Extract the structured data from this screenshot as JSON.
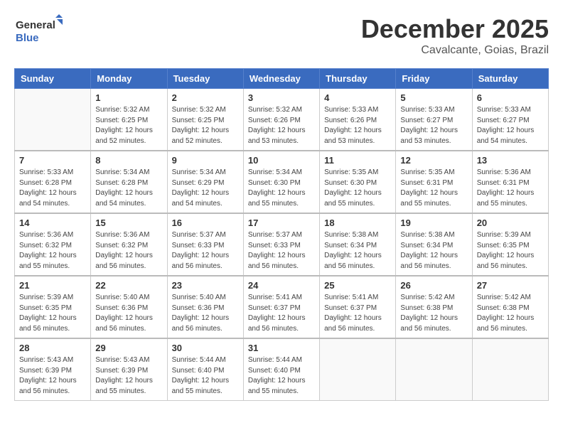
{
  "logo": {
    "line1": "General",
    "line2": "Blue"
  },
  "title": "December 2025",
  "location": "Cavalcante, Goias, Brazil",
  "weekdays": [
    "Sunday",
    "Monday",
    "Tuesday",
    "Wednesday",
    "Thursday",
    "Friday",
    "Saturday"
  ],
  "weeks": [
    [
      {
        "day": "",
        "empty": true
      },
      {
        "day": "1",
        "sunrise": "5:32 AM",
        "sunset": "6:25 PM",
        "daylight": "12 hours and 52 minutes."
      },
      {
        "day": "2",
        "sunrise": "5:32 AM",
        "sunset": "6:25 PM",
        "daylight": "12 hours and 52 minutes."
      },
      {
        "day": "3",
        "sunrise": "5:32 AM",
        "sunset": "6:26 PM",
        "daylight": "12 hours and 53 minutes."
      },
      {
        "day": "4",
        "sunrise": "5:33 AM",
        "sunset": "6:26 PM",
        "daylight": "12 hours and 53 minutes."
      },
      {
        "day": "5",
        "sunrise": "5:33 AM",
        "sunset": "6:27 PM",
        "daylight": "12 hours and 53 minutes."
      },
      {
        "day": "6",
        "sunrise": "5:33 AM",
        "sunset": "6:27 PM",
        "daylight": "12 hours and 54 minutes."
      }
    ],
    [
      {
        "day": "7",
        "sunrise": "5:33 AM",
        "sunset": "6:28 PM",
        "daylight": "12 hours and 54 minutes."
      },
      {
        "day": "8",
        "sunrise": "5:34 AM",
        "sunset": "6:28 PM",
        "daylight": "12 hours and 54 minutes."
      },
      {
        "day": "9",
        "sunrise": "5:34 AM",
        "sunset": "6:29 PM",
        "daylight": "12 hours and 54 minutes."
      },
      {
        "day": "10",
        "sunrise": "5:34 AM",
        "sunset": "6:30 PM",
        "daylight": "12 hours and 55 minutes."
      },
      {
        "day": "11",
        "sunrise": "5:35 AM",
        "sunset": "6:30 PM",
        "daylight": "12 hours and 55 minutes."
      },
      {
        "day": "12",
        "sunrise": "5:35 AM",
        "sunset": "6:31 PM",
        "daylight": "12 hours and 55 minutes."
      },
      {
        "day": "13",
        "sunrise": "5:36 AM",
        "sunset": "6:31 PM",
        "daylight": "12 hours and 55 minutes."
      }
    ],
    [
      {
        "day": "14",
        "sunrise": "5:36 AM",
        "sunset": "6:32 PM",
        "daylight": "12 hours and 55 minutes."
      },
      {
        "day": "15",
        "sunrise": "5:36 AM",
        "sunset": "6:32 PM",
        "daylight": "12 hours and 56 minutes."
      },
      {
        "day": "16",
        "sunrise": "5:37 AM",
        "sunset": "6:33 PM",
        "daylight": "12 hours and 56 minutes."
      },
      {
        "day": "17",
        "sunrise": "5:37 AM",
        "sunset": "6:33 PM",
        "daylight": "12 hours and 56 minutes."
      },
      {
        "day": "18",
        "sunrise": "5:38 AM",
        "sunset": "6:34 PM",
        "daylight": "12 hours and 56 minutes."
      },
      {
        "day": "19",
        "sunrise": "5:38 AM",
        "sunset": "6:34 PM",
        "daylight": "12 hours and 56 minutes."
      },
      {
        "day": "20",
        "sunrise": "5:39 AM",
        "sunset": "6:35 PM",
        "daylight": "12 hours and 56 minutes."
      }
    ],
    [
      {
        "day": "21",
        "sunrise": "5:39 AM",
        "sunset": "6:35 PM",
        "daylight": "12 hours and 56 minutes."
      },
      {
        "day": "22",
        "sunrise": "5:40 AM",
        "sunset": "6:36 PM",
        "daylight": "12 hours and 56 minutes."
      },
      {
        "day": "23",
        "sunrise": "5:40 AM",
        "sunset": "6:36 PM",
        "daylight": "12 hours and 56 minutes."
      },
      {
        "day": "24",
        "sunrise": "5:41 AM",
        "sunset": "6:37 PM",
        "daylight": "12 hours and 56 minutes."
      },
      {
        "day": "25",
        "sunrise": "5:41 AM",
        "sunset": "6:37 PM",
        "daylight": "12 hours and 56 minutes."
      },
      {
        "day": "26",
        "sunrise": "5:42 AM",
        "sunset": "6:38 PM",
        "daylight": "12 hours and 56 minutes."
      },
      {
        "day": "27",
        "sunrise": "5:42 AM",
        "sunset": "6:38 PM",
        "daylight": "12 hours and 56 minutes."
      }
    ],
    [
      {
        "day": "28",
        "sunrise": "5:43 AM",
        "sunset": "6:39 PM",
        "daylight": "12 hours and 56 minutes."
      },
      {
        "day": "29",
        "sunrise": "5:43 AM",
        "sunset": "6:39 PM",
        "daylight": "12 hours and 55 minutes."
      },
      {
        "day": "30",
        "sunrise": "5:44 AM",
        "sunset": "6:40 PM",
        "daylight": "12 hours and 55 minutes."
      },
      {
        "day": "31",
        "sunrise": "5:44 AM",
        "sunset": "6:40 PM",
        "daylight": "12 hours and 55 minutes."
      },
      {
        "day": "",
        "empty": true
      },
      {
        "day": "",
        "empty": true
      },
      {
        "day": "",
        "empty": true
      }
    ]
  ],
  "labels": {
    "sunrise": "Sunrise:",
    "sunset": "Sunset:",
    "daylight": "Daylight:"
  }
}
